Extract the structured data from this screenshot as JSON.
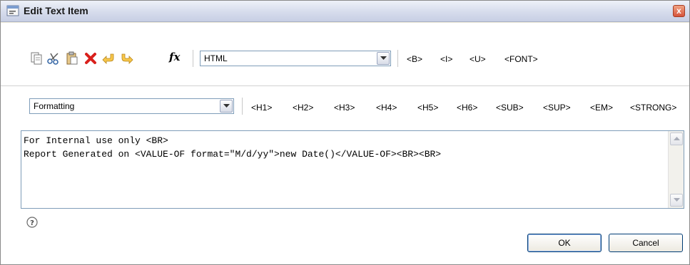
{
  "window": {
    "title": "Edit Text Item",
    "close_label": "x"
  },
  "toolbar": {
    "icons": [
      "copy-icon",
      "cut-icon",
      "paste-icon",
      "delete-icon",
      "undo-icon",
      "redo-icon",
      "function-icon"
    ],
    "function_label": "fx",
    "content_type_select": {
      "value": "HTML"
    },
    "basic_tags": [
      "<B>",
      "<I>",
      "<U>",
      "<FONT>"
    ]
  },
  "formatting": {
    "select": {
      "value": "Formatting"
    },
    "tags": [
      "<H1>",
      "<H2>",
      "<H3>",
      "<H4>",
      "<H5>",
      "<H6>",
      "<SUB>",
      "<SUP>",
      "<EM>",
      "<STRONG>"
    ]
  },
  "editor": {
    "lines": [
      "For Internal use only <BR>",
      "Report Generated on <VALUE-OF format=\"M/d/yy\">new Date()</VALUE-OF><BR><BR>"
    ]
  },
  "footer": {
    "help_label": "?",
    "ok_label": "OK",
    "cancel_label": "Cancel"
  },
  "colors": {
    "delete_icon": "#d9201c",
    "arrow_icons": "#f0b030",
    "title_bar": "#d6dcec"
  }
}
